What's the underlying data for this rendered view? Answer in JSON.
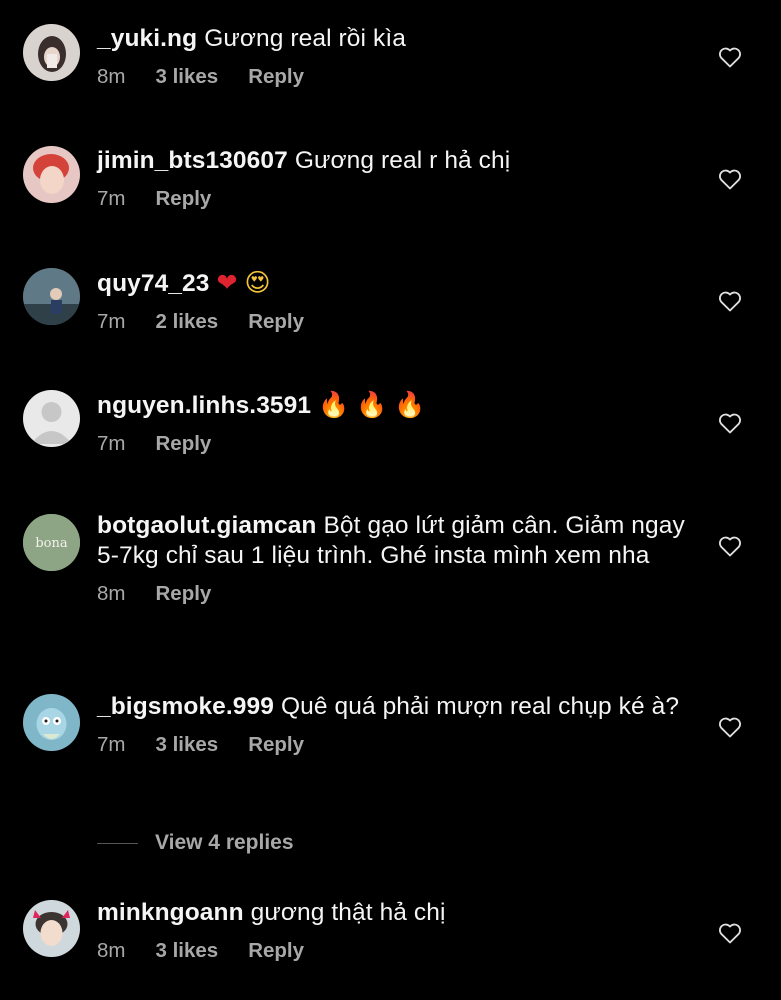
{
  "colors": {
    "background": "#000000",
    "text": "#f5f5f5",
    "muted": "#a8a8a8"
  },
  "comments": [
    {
      "username": "_yuki.ng",
      "text": "Gương real rồi kìa",
      "time": "8m",
      "likes": "3 likes",
      "reply": "Reply",
      "avatar": "photo-avatar"
    },
    {
      "username": "jimin_bts130607",
      "text": "Gương real r hả chị",
      "time": "7m",
      "likes": "",
      "reply": "Reply",
      "avatar": "photo-avatar"
    },
    {
      "username": "quy74_23",
      "text": "",
      "emojis": [
        "red-heart-emoji",
        "heart-eyes-emoji"
      ],
      "time": "7m",
      "likes": "2 likes",
      "reply": "Reply",
      "avatar": "photo-avatar"
    },
    {
      "username": "nguyen.linhs.3591",
      "text": "",
      "emojis": [
        "fire-emoji",
        "fire-emoji",
        "fire-emoji"
      ],
      "time": "7m",
      "likes": "",
      "reply": "Reply",
      "avatar": "default-avatar"
    },
    {
      "username": "botgaolut.giamcan",
      "text": "Bột gạo lứt giảm cân. Giảm ngay 5-7kg chỉ sau 1 liệu trình. Ghé insta mình xem nha",
      "time": "8m",
      "likes": "",
      "reply": "Reply",
      "avatar": "logo-avatar",
      "avatar_text": "bona"
    },
    {
      "username": "_bigsmoke.999",
      "text": "Quê quá phải mượn real chụp ké à?",
      "time": "7m",
      "likes": "3 likes",
      "reply": "Reply",
      "avatar": "cartoon-avatar"
    },
    {
      "username": "minkngoann",
      "text": "gương thật hả chị",
      "time": "8m",
      "likes": "3 likes",
      "reply": "Reply",
      "avatar": "photo-avatar"
    }
  ],
  "view_replies": "View 4 replies"
}
